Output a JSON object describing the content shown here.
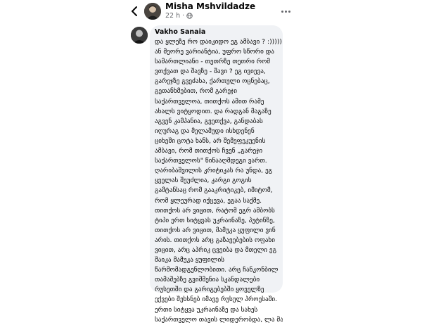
{
  "header": {
    "author_name": "Misha Mshvildadze",
    "time": "22 h",
    "privacy_icon": "globe-icon",
    "back_icon": "chevron-left-icon",
    "more_icon": "more-dots-icon"
  },
  "comment": {
    "author": "Vakho Sanaia",
    "lines": [
      "და ყლეზე რო დაიკიდო ეგ ამბავი ? :)))))",
      "ან მეორე ვარიანტია, უფრო სწორი და",
      "სამართლიანი - თეთრზე თეთრი რომ",
      "ვთქვათ და შავზე - შავი ? ეგ ივიევა,",
      "გარეჯზე გვეძახა, ქართული ოცნებაც,",
      "გეთანხმებით, რომ გარეჯი",
      "საქართველოა, თითქოს ამით რამე",
      "ახალს ვიტყოდით. და რადგან მაგაზე",
      "აგვენ კამპანია, გვეთქვა, განდაბას",
      "იღურაგ და მელამუდი ისხდენენ",
      "ციხეში ცოტა ხანს, არ შემეფეკუენის",
      "ამბავი, რომ თითქოს ჩვენ „გარეჯი",
      "საქართველოს\" წინააღმდეგი ვართ.",
      "ღარიბაშვილის კრიტიკას რა უნდა, ეგ",
      "ყველას შეუძლია, კარგი გოგის",
      "გამტანსაც რომ გააკრიტიკებ, იმიტომ,",
      "რომ ყლეურად იქცევა, ეგაა საქმე.",
      "თითქოს არ ვიცით, რატომ ეგრ ამბობს",
      "ტიპი ერთ სიტყვას უკრაინაზე, პუტინზე,",
      "თითქოს არ ვიცით, მამუკა ყუფილი ვინ",
      "არის. თითქოს არც გაზავებების ოფახი",
      "ვიცით, არც აპრიკ ცვეიბა და მთელი ეგ",
      "შაიკა მამუკა ყუფილის",
      "წარმომადგენლობითი. არც ჩანკონბილ",
      "თამაშებზე გვიშმენია სკანდალები",
      "რუსეთში და გარიგებებში ყოველზე",
      "ექვები შეხსნებ იმავე რუსულ პროესაში.",
      "ერთი სიტყვა უკრაინაზე და სახეს",
      "საქართველო თავის ლიდერობდა, ლა მადის"
    ]
  }
}
